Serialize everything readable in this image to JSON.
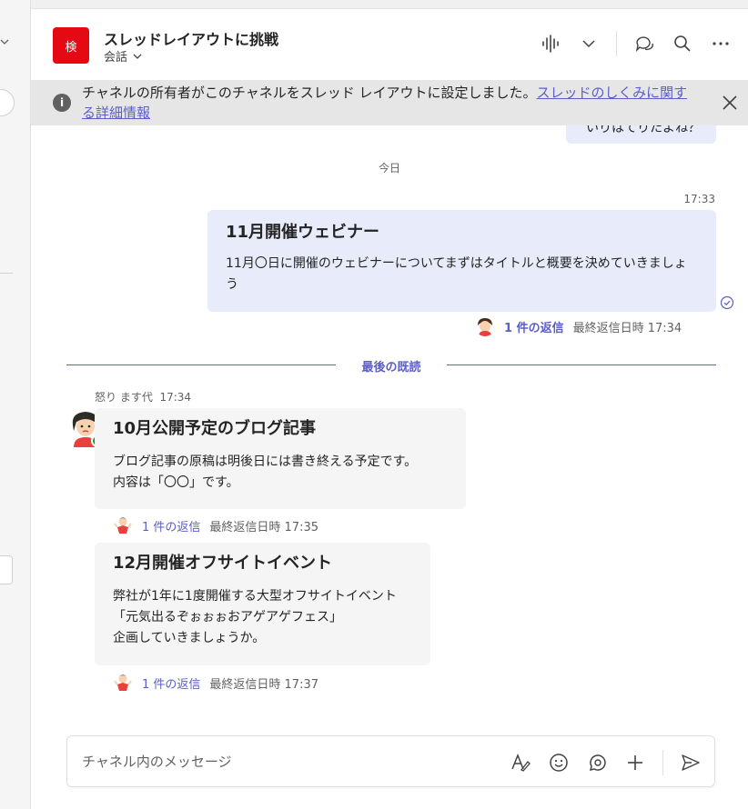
{
  "header": {
    "avatar_text": "検",
    "title": "スレッドレイアウトに挑戦",
    "subtitle": "会話"
  },
  "banner": {
    "text": "チャネルの所有者がこのチャネルをスレッド レイアウトに設定しました。",
    "link": "スレッドのしくみに関する詳細情報"
  },
  "peek_text": "いりはてりたよね？",
  "date_separator": "今日",
  "my_message": {
    "time": "17:33",
    "title": "11月開催ウェビナー",
    "body": "11月〇日に開催のウェビナーについてまずはタイトルと概要を決めていきましょう",
    "reply_count": "1 件の返信",
    "last_reply": "最終返信日時 17:34"
  },
  "last_read_label": "最後の既読",
  "sender": {
    "name": "怒り ます代",
    "time": "17:34"
  },
  "posts": [
    {
      "title": "10月公開予定のブログ記事",
      "body_line1": "ブログ記事の原稿は明後日には書き終える予定です。",
      "body_line2": "内容は「〇〇」です。",
      "reply_count": "1 件の返信",
      "last_reply": "最終返信日時 17:35"
    },
    {
      "title": "12月開催オフサイトイベント",
      "body_line1": "弊社が1年に1度開催する大型オフサイトイベント",
      "body_line2": "「元気出るぞぉぉぉおアゲアゲフェス」",
      "body_line3": "企画していきましょうか。",
      "reply_count": "1 件の返信",
      "last_reply": "最終返信日時 17:37"
    }
  ],
  "compose": {
    "placeholder": "チャネル内のメッセージ"
  },
  "colors": {
    "brand": "#5b5fc7",
    "channel_avatar": "#e50914",
    "my_bubble": "#e8ebfa",
    "their_bubble": "#f5f5f5",
    "presence": "#13a10e"
  },
  "icons": [
    "audio-wave-icon",
    "chevron-down-icon",
    "conversation-icon",
    "search-icon",
    "more-icon",
    "info-icon",
    "close-icon",
    "sent-check-icon",
    "format-icon",
    "emoji-icon",
    "loop-icon",
    "plus-icon",
    "send-icon"
  ]
}
